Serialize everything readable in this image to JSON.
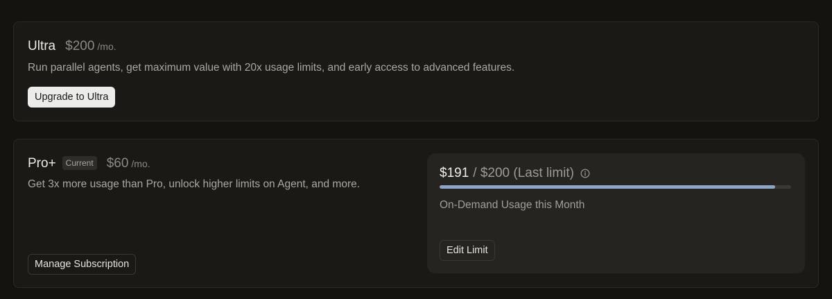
{
  "ultra": {
    "name": "Ultra",
    "price": "$200",
    "per": "/mo.",
    "description": "Run parallel agents, get maximum value with 20x usage limits, and early access to advanced features.",
    "button_label": "Upgrade to Ultra"
  },
  "pro_plus": {
    "name": "Pro+",
    "badge": "Current",
    "price": "$60",
    "per": "/mo.",
    "description": "Get 3x more usage than Pro, unlock higher limits on Agent, and more.",
    "button_label": "Manage Subscription"
  },
  "usage": {
    "current": "$191",
    "limit_text": "/ $200 (Last limit)",
    "fraction": 0.955,
    "label": "On-Demand Usage this Month",
    "edit_button_label": "Edit Limit",
    "info_icon": "info-circle-icon",
    "bar_color": "#8ea4c4"
  }
}
